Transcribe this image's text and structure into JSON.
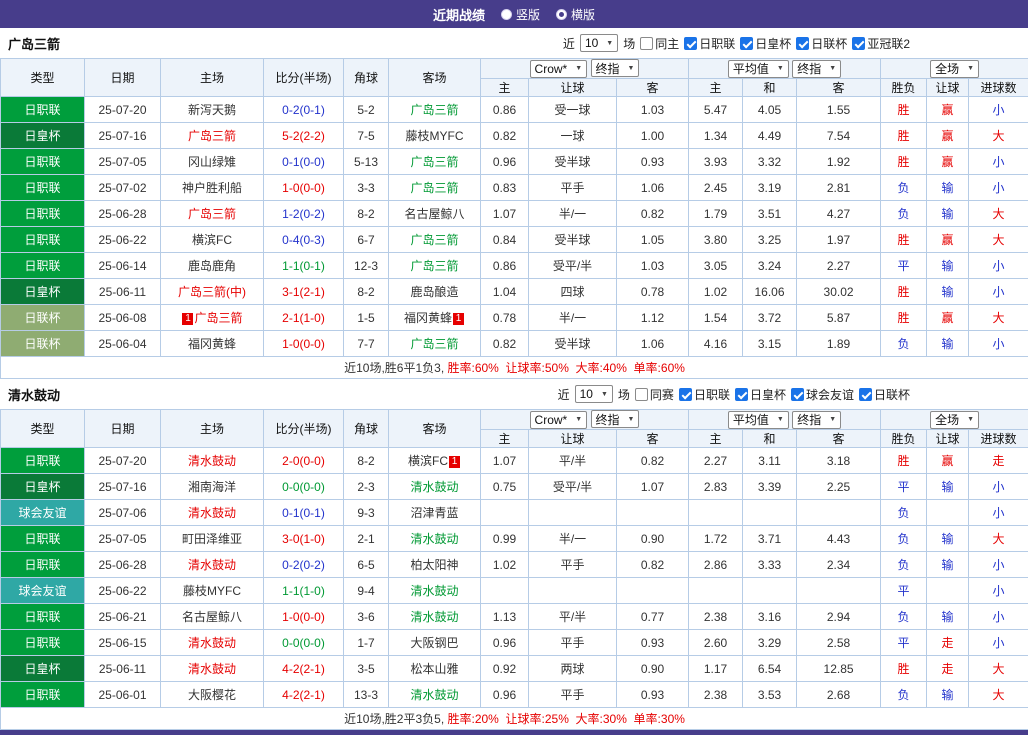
{
  "topbar": {
    "title": "近期战绩",
    "radios": [
      {
        "label": "竖版",
        "selected": false
      },
      {
        "label": "横版",
        "selected": true
      }
    ]
  },
  "palette": {
    "red": "#e60000",
    "green": "#009933",
    "blue": "#2333cc",
    "black": "#333333"
  },
  "league_colors": {
    "日职联": "#009e3c",
    "日皇杯": "#0a7a38",
    "日联杯": "#8fac72",
    "球会友谊": "#2fa8a5"
  },
  "table": {
    "cols": [
      "类型",
      "日期",
      "主场",
      "比分(半场)",
      "角球",
      "客场"
    ],
    "subcols": [
      "主",
      "让球",
      "客",
      "主",
      "和",
      "客",
      "胜负",
      "让球",
      "进球数"
    ],
    "dropdowns": {
      "book": "Crow*",
      "ref1": "终指",
      "avg": "平均值",
      "ref2": "终指",
      "scope": "全场"
    }
  },
  "sections": [
    {
      "team": "广岛三箭",
      "filters": {
        "near": "近",
        "count": "10",
        "games": "场",
        "same": {
          "label": "同主",
          "checked": false
        },
        "leagues": [
          {
            "label": "日职联",
            "checked": true
          },
          {
            "label": "日皇杯",
            "checked": true
          },
          {
            "label": "日联杯",
            "checked": true
          },
          {
            "label": "亚冠联2",
            "checked": true
          }
        ]
      },
      "rows": [
        {
          "lg": "日职联",
          "date": "25-07-20",
          "h": "新泻天鹅",
          "hcol": "black",
          "score": "0-2(0-1)",
          "scol": "blue",
          "corner": "5-2",
          "a": "广岛三箭",
          "acol": "green",
          "a1": "0.86",
          "line": "受一球",
          "a2": "1.03",
          "e1": "5.47",
          "e2": "4.05",
          "e3": "1.55",
          "r1": "胜",
          "r1c": "red",
          "r2": "赢",
          "r2c": "red",
          "r3": "小",
          "r3c": "blue"
        },
        {
          "lg": "日皇杯",
          "date": "25-07-16",
          "h": "广岛三箭",
          "hcol": "red",
          "score": "5-2(2-2)",
          "scol": "red",
          "corner": "7-5",
          "a": "藤枝MYFC",
          "acol": "black",
          "a1": "0.82",
          "line": "一球",
          "a2": "1.00",
          "e1": "1.34",
          "e2": "4.49",
          "e3": "7.54",
          "r1": "胜",
          "r1c": "red",
          "r2": "赢",
          "r2c": "red",
          "r3": "大",
          "r3c": "red"
        },
        {
          "lg": "日职联",
          "date": "25-07-05",
          "h": "冈山绿雉",
          "hcol": "black",
          "score": "0-1(0-0)",
          "scol": "blue",
          "corner": "5-13",
          "a": "广岛三箭",
          "acol": "green",
          "a1": "0.96",
          "line": "受半球",
          "a2": "0.93",
          "e1": "3.93",
          "e2": "3.32",
          "e3": "1.92",
          "r1": "胜",
          "r1c": "red",
          "r2": "赢",
          "r2c": "red",
          "r3": "小",
          "r3c": "blue"
        },
        {
          "lg": "日职联",
          "date": "25-07-02",
          "h": "神户胜利船",
          "hcol": "black",
          "score": "1-0(0-0)",
          "scol": "red",
          "corner": "3-3",
          "a": "广岛三箭",
          "acol": "green",
          "a1": "0.83",
          "line": "平手",
          "a2": "1.06",
          "e1": "2.45",
          "e2": "3.19",
          "e3": "2.81",
          "r1": "负",
          "r1c": "blue",
          "r2": "输",
          "r2c": "blue",
          "r3": "小",
          "r3c": "blue"
        },
        {
          "lg": "日职联",
          "date": "25-06-28",
          "h": "广岛三箭",
          "hcol": "red",
          "score": "1-2(0-2)",
          "scol": "blue",
          "corner": "8-2",
          "a": "名古屋鲸八",
          "acol": "black",
          "a1": "1.07",
          "line": "半/一",
          "a2": "0.82",
          "e1": "1.79",
          "e2": "3.51",
          "e3": "4.27",
          "r1": "负",
          "r1c": "blue",
          "r2": "输",
          "r2c": "blue",
          "r3": "大",
          "r3c": "red"
        },
        {
          "lg": "日职联",
          "date": "25-06-22",
          "h": "横滨FC",
          "hcol": "black",
          "score": "0-4(0-3)",
          "scol": "blue",
          "corner": "6-7",
          "a": "广岛三箭",
          "acol": "green",
          "a1": "0.84",
          "line": "受半球",
          "a2": "1.05",
          "e1": "3.80",
          "e2": "3.25",
          "e3": "1.97",
          "r1": "胜",
          "r1c": "red",
          "r2": "赢",
          "r2c": "red",
          "r3": "大",
          "r3c": "red"
        },
        {
          "lg": "日职联",
          "date": "25-06-14",
          "h": "鹿岛鹿角",
          "hcol": "black",
          "score": "1-1(0-1)",
          "scol": "green",
          "corner": "12-3",
          "a": "广岛三箭",
          "acol": "green",
          "a1": "0.86",
          "line": "受平/半",
          "a2": "1.03",
          "e1": "3.05",
          "e2": "3.24",
          "e3": "2.27",
          "r1": "平",
          "r1c": "blue",
          "r2": "输",
          "r2c": "blue",
          "r3": "小",
          "r3c": "blue"
        },
        {
          "lg": "日皇杯",
          "date": "25-06-11",
          "h": "广岛三箭(中)",
          "hcol": "red",
          "score": "3-1(2-1)",
          "scol": "red",
          "corner": "8-2",
          "a": "鹿岛酿造",
          "acol": "black",
          "a1": "1.04",
          "line": "四球",
          "a2": "0.78",
          "e1": "1.02",
          "e2": "16.06",
          "e3": "30.02",
          "r1": "胜",
          "r1c": "red",
          "r2": "输",
          "r2c": "blue",
          "r3": "小",
          "r3c": "blue"
        },
        {
          "lg": "日联杯",
          "date": "25-06-08",
          "hpre": "1",
          "h": "广岛三箭",
          "hcol": "red",
          "score": "2-1(1-0)",
          "scol": "red",
          "corner": "1-5",
          "a": "福冈黄蜂",
          "apost": "1",
          "acol": "black",
          "a1": "0.78",
          "line": "半/一",
          "a2": "1.12",
          "e1": "1.54",
          "e2": "3.72",
          "e3": "5.87",
          "r1": "胜",
          "r1c": "red",
          "r2": "赢",
          "r2c": "red",
          "r3": "大",
          "r3c": "red"
        },
        {
          "lg": "日联杯",
          "date": "25-06-04",
          "h": "福冈黄蜂",
          "hcol": "black",
          "score": "1-0(0-0)",
          "scol": "red",
          "corner": "7-7",
          "a": "广岛三箭",
          "acol": "green",
          "a1": "0.82",
          "line": "受半球",
          "a2": "1.06",
          "e1": "4.16",
          "e2": "3.15",
          "e3": "1.89",
          "r1": "负",
          "r1c": "blue",
          "r2": "输",
          "r2c": "blue",
          "r3": "小",
          "r3c": "blue"
        }
      ],
      "footer": {
        "summary": "近10场,胜6平1负3,",
        "stats": "胜率:60%  让球率:50%  大率:40%  单率:60%"
      }
    },
    {
      "team": "清水鼓动",
      "filters": {
        "near": "近",
        "count": "10",
        "games": "场",
        "same": {
          "label": "同赛",
          "checked": false
        },
        "leagues": [
          {
            "label": "日职联",
            "checked": true
          },
          {
            "label": "日皇杯",
            "checked": true
          },
          {
            "label": "球会友谊",
            "checked": true
          },
          {
            "label": "日联杯",
            "checked": true
          }
        ]
      },
      "rows": [
        {
          "lg": "日职联",
          "date": "25-07-20",
          "h": "清水鼓动",
          "hcol": "red",
          "score": "2-0(0-0)",
          "scol": "red",
          "corner": "8-2",
          "a": "横滨FC",
          "apost": "1",
          "acol": "black",
          "a1": "1.07",
          "line": "平/半",
          "a2": "0.82",
          "e1": "2.27",
          "e2": "3.11",
          "e3": "3.18",
          "r1": "胜",
          "r1c": "red",
          "r2": "赢",
          "r2c": "red",
          "r3": "走",
          "r3c": "red"
        },
        {
          "lg": "日皇杯",
          "date": "25-07-16",
          "h": "湘南海洋",
          "hcol": "black",
          "score": "0-0(0-0)",
          "scol": "green",
          "corner": "2-3",
          "a": "清水鼓动",
          "acol": "green",
          "a1": "0.75",
          "line": "受平/半",
          "a2": "1.07",
          "e1": "2.83",
          "e2": "3.39",
          "e3": "2.25",
          "r1": "平",
          "r1c": "blue",
          "r2": "输",
          "r2c": "blue",
          "r3": "小",
          "r3c": "blue"
        },
        {
          "lg": "球会友谊",
          "date": "25-07-06",
          "h": "清水鼓动",
          "hcol": "red",
          "score": "0-1(0-1)",
          "scol": "blue",
          "corner": "9-3",
          "a": "沼津青蓝",
          "acol": "black",
          "a1": "",
          "line": "",
          "a2": "",
          "e1": "",
          "e2": "",
          "e3": "",
          "r1": "负",
          "r1c": "blue",
          "r2": "",
          "r2c": "blue",
          "r3": "小",
          "r3c": "blue"
        },
        {
          "lg": "日职联",
          "date": "25-07-05",
          "h": "町田泽维亚",
          "hcol": "black",
          "score": "3-0(1-0)",
          "scol": "red",
          "corner": "2-1",
          "a": "清水鼓动",
          "acol": "green",
          "a1": "0.99",
          "line": "半/一",
          "a2": "0.90",
          "e1": "1.72",
          "e2": "3.71",
          "e3": "4.43",
          "r1": "负",
          "r1c": "blue",
          "r2": "输",
          "r2c": "blue",
          "r3": "大",
          "r3c": "red"
        },
        {
          "lg": "日职联",
          "date": "25-06-28",
          "h": "清水鼓动",
          "hcol": "red",
          "score": "0-2(0-2)",
          "scol": "blue",
          "corner": "6-5",
          "a": "柏太阳神",
          "acol": "black",
          "a1": "1.02",
          "line": "平手",
          "a2": "0.82",
          "e1": "2.86",
          "e2": "3.33",
          "e3": "2.34",
          "r1": "负",
          "r1c": "blue",
          "r2": "输",
          "r2c": "blue",
          "r3": "小",
          "r3c": "blue"
        },
        {
          "lg": "球会友谊",
          "date": "25-06-22",
          "h": "藤枝MYFC",
          "hcol": "black",
          "score": "1-1(1-0)",
          "scol": "green",
          "corner": "9-4",
          "a": "清水鼓动",
          "acol": "green",
          "a1": "",
          "line": "",
          "a2": "",
          "e1": "",
          "e2": "",
          "e3": "",
          "r1": "平",
          "r1c": "blue",
          "r2": "",
          "r2c": "blue",
          "r3": "小",
          "r3c": "blue"
        },
        {
          "lg": "日职联",
          "date": "25-06-21",
          "h": "名古屋鲸八",
          "hcol": "black",
          "score": "1-0(0-0)",
          "scol": "red",
          "corner": "3-6",
          "a": "清水鼓动",
          "acol": "green",
          "a1": "1.13",
          "line": "平/半",
          "a2": "0.77",
          "e1": "2.38",
          "e2": "3.16",
          "e3": "2.94",
          "r1": "负",
          "r1c": "blue",
          "r2": "输",
          "r2c": "blue",
          "r3": "小",
          "r3c": "blue"
        },
        {
          "lg": "日职联",
          "date": "25-06-15",
          "h": "清水鼓动",
          "hcol": "red",
          "score": "0-0(0-0)",
          "scol": "green",
          "corner": "1-7",
          "a": "大阪钢巴",
          "acol": "black",
          "a1": "0.96",
          "line": "平手",
          "a2": "0.93",
          "e1": "2.60",
          "e2": "3.29",
          "e3": "2.58",
          "r1": "平",
          "r1c": "blue",
          "r2": "走",
          "r2c": "red",
          "r3": "小",
          "r3c": "blue"
        },
        {
          "lg": "日皇杯",
          "date": "25-06-11",
          "h": "清水鼓动",
          "hcol": "red",
          "score": "4-2(2-1)",
          "scol": "red",
          "corner": "3-5",
          "a": "松本山雅",
          "acol": "black",
          "a1": "0.92",
          "line": "两球",
          "a2": "0.90",
          "e1": "1.17",
          "e2": "6.54",
          "e3": "12.85",
          "r1": "胜",
          "r1c": "red",
          "r2": "走",
          "r2c": "red",
          "r3": "大",
          "r3c": "red"
        },
        {
          "lg": "日职联",
          "date": "25-06-01",
          "h": "大阪樱花",
          "hcol": "black",
          "score": "4-2(2-1)",
          "scol": "red",
          "corner": "13-3",
          "a": "清水鼓动",
          "acol": "green",
          "a1": "0.96",
          "line": "平手",
          "a2": "0.93",
          "e1": "2.38",
          "e2": "3.53",
          "e3": "2.68",
          "r1": "负",
          "r1c": "blue",
          "r2": "输",
          "r2c": "blue",
          "r3": "大",
          "r3c": "red"
        }
      ],
      "footer": {
        "summary": "近10场,胜2平3负5,",
        "stats": "胜率:20%  让球率:25%  大率:30%  单率:30%"
      }
    }
  ]
}
